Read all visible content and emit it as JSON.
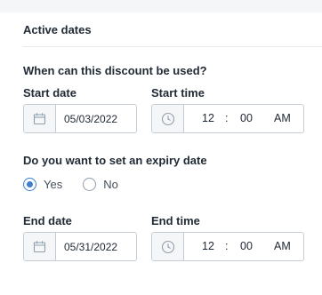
{
  "section": {
    "title": "Active dates"
  },
  "usage": {
    "question": "When can this discount be used?"
  },
  "start": {
    "date_label": "Start date",
    "date_value": "05/03/2022",
    "time_label": "Start time",
    "hour": "12",
    "separator": ":",
    "minute": "00",
    "ampm": "AM"
  },
  "expiry": {
    "question": "Do you want to set an expiry date",
    "options": [
      {
        "label": "Yes",
        "selected": true
      },
      {
        "label": "No",
        "selected": false
      }
    ]
  },
  "end": {
    "date_label": "End date",
    "date_value": "05/31/2022",
    "time_label": "End time",
    "hour": "12",
    "separator": ":",
    "minute": "00",
    "ampm": "AM"
  },
  "icons": {
    "date": "calendar-icon",
    "time": "clock-icon"
  },
  "colors": {
    "accent": "#3f7fcf",
    "border": "#c4cdd5",
    "prefix_bg": "#f4f6f8"
  }
}
